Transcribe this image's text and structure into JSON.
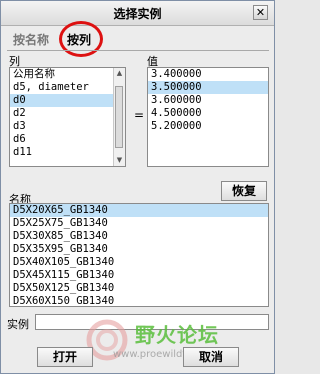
{
  "window": {
    "title": "选择实例"
  },
  "tabs": [
    {
      "label": "按名称"
    },
    {
      "label": "按列"
    }
  ],
  "column_section": {
    "label": "列",
    "items": [
      "公用名称",
      "d5, diameter",
      "d0",
      "d2",
      "d3",
      "d6",
      "d11"
    ],
    "selected_index": 2
  },
  "equals": "=",
  "value_section": {
    "label": "值",
    "items": [
      "3.400000",
      "3.500000",
      "3.600000",
      "4.500000",
      "5.200000"
    ],
    "selected_index": 1
  },
  "name_section": {
    "label": "名称",
    "reset_button": "恢复",
    "items": [
      "D5X20X65_GB1340",
      "D5X25X75_GB1340",
      "D5X30X85_GB1340",
      "D5X35X95_GB1340",
      "D5X40X105_GB1340",
      "D5X45X115_GB1340",
      "D5X50X125_GB1340",
      "D5X60X150_GB1340"
    ],
    "selected_index": 0
  },
  "instance": {
    "label": "实例",
    "value": ""
  },
  "buttons": {
    "open": "打开",
    "cancel": "取消"
  },
  "watermark": {
    "text": "野火论坛",
    "url": "www.proewildfire.cn"
  },
  "close_glyph": "✕",
  "colors": {
    "selection": "#bfe0f7",
    "highlight_circle": "#dd1111",
    "watermark": "#5abf3c"
  }
}
